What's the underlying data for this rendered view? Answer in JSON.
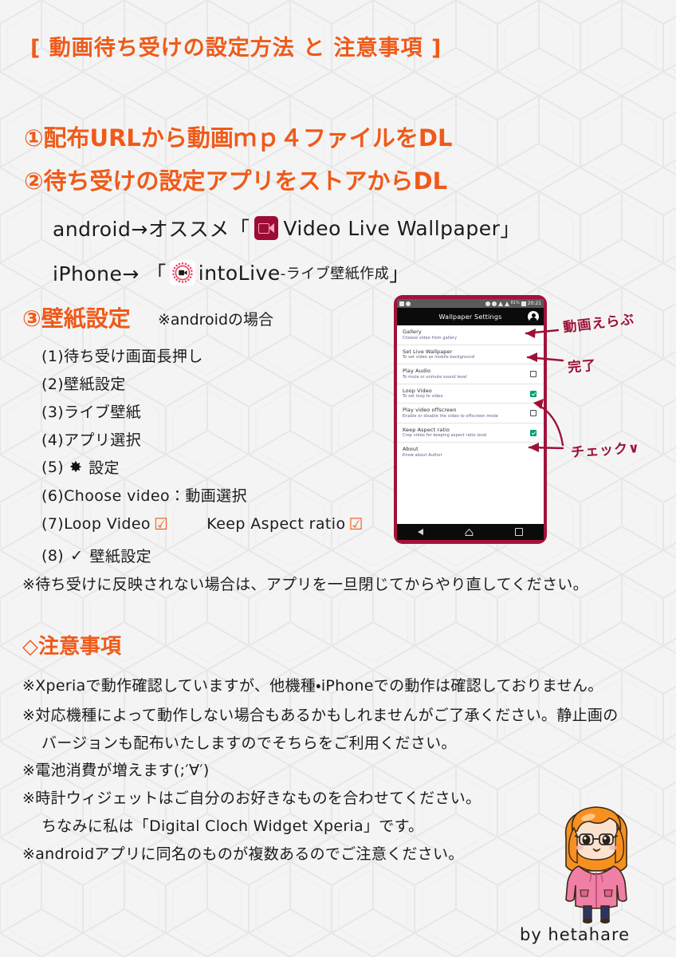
{
  "page": {
    "title": "[ 動画待ち受けの設定方法 と 注意事項 ]",
    "background_color": "#f4f4f4",
    "accent_color": "#ef5a19",
    "text_color": "#1b1b1b",
    "handwriting_color": "#9c1236"
  },
  "steps": {
    "step1": "①配布URLから動画ｍｐ４ファイルをDL",
    "step2": "②待ち受けの設定アプリをストアからDL",
    "android": {
      "prefix": "android→オススメ「",
      "icon": "video-live-wallpaper-icon",
      "app_name": "Video Live Wallpaper",
      "suffix": "」"
    },
    "iphone": {
      "prefix": "iPhone→ 「",
      "icon": "intolive-icon",
      "app_name": "intoLive",
      "app_name_small": "-ライブ壁紙作成",
      "suffix": "」"
    },
    "step3": "③壁紙設定",
    "step3_note": "※androidの場合"
  },
  "substeps": [
    {
      "label": "(1)待ち受け画面長押し"
    },
    {
      "label": "(2)壁紙設定"
    },
    {
      "label": "(3)ライブ壁紙"
    },
    {
      "label": "(4)アプリ選択"
    },
    {
      "prefix": "(5)",
      "icon": "gear-icon",
      "label": "設定"
    },
    {
      "label": "(6)Choose video：動画選択"
    },
    {
      "prefix": "(7)Loop Video",
      "check1": "☑",
      "label2": "Keep Aspect ratio",
      "check2": "☑"
    },
    {
      "prefix": "(8)",
      "check": "✓",
      "label": "壁紙設定"
    }
  ],
  "note_reflect": "※待ち受けに反映されない場合は、アプリを一旦閉じてからやり直してください。",
  "caution": {
    "heading": "◇注意事項",
    "lines": [
      "※Xperiaで動作確認していますが、他機種・iPhoneでの動作は確認しておりません。",
      "※対応機種によって動作しない場合もあるかもしれませんがご了承ください。静止画の",
      "バージョンも配布いたしますのでそちらをご利用ください。",
      "※電池消費が増えます(;′∀′)",
      "※時計ウィジェットはご自分のお好きなものを合わせてください。",
      "ちなみに私は「Digital Cloch Widget Xperia」です。",
      "※androidアプリに同名のものが複数あるのでご注意ください。"
    ]
  },
  "phone": {
    "status_bar": {
      "time": "20:21",
      "battery_pct": "81%",
      "left_icons": [
        "image-icon",
        "sync-icon"
      ],
      "right_icons": [
        "brightness-icon",
        "alarm-icon",
        "wifi-icon",
        "signal-icon",
        "battery-icon"
      ]
    },
    "app_bar": {
      "title": "Wallpaper Settings",
      "avatar": "account-avatar-icon"
    },
    "settings": [
      {
        "title": "Gallery",
        "subtitle": "Choose video from gallery",
        "checkbox": "none"
      },
      {
        "title": "Set Live Wallpaper",
        "subtitle": "To set video as mobile background",
        "checkbox": "none"
      },
      {
        "title": "Play Audio",
        "subtitle": "To mute or unmute sound level",
        "checkbox": "unchecked"
      },
      {
        "title": "Loop Video",
        "subtitle": "To set loop to video",
        "checkbox": "checked"
      },
      {
        "title": "Play video offscreen",
        "subtitle": "Enable or disable the video to offscreen mode",
        "checkbox": "unchecked"
      },
      {
        "title": "Keep Aspect ratio",
        "subtitle": "Crop video for keeping aspect ratio level",
        "checkbox": "checked"
      },
      {
        "title": "About",
        "subtitle": "Know about Author",
        "checkbox": "none"
      }
    ],
    "nav_bar": [
      "back-icon",
      "home-icon",
      "recents-icon"
    ]
  },
  "annotations": {
    "select_video": "動画えらぶ",
    "done": "完了",
    "check": "チェック∨"
  },
  "footer": {
    "signature": "by  hetahare",
    "character": "chibi-girl-illustration"
  }
}
